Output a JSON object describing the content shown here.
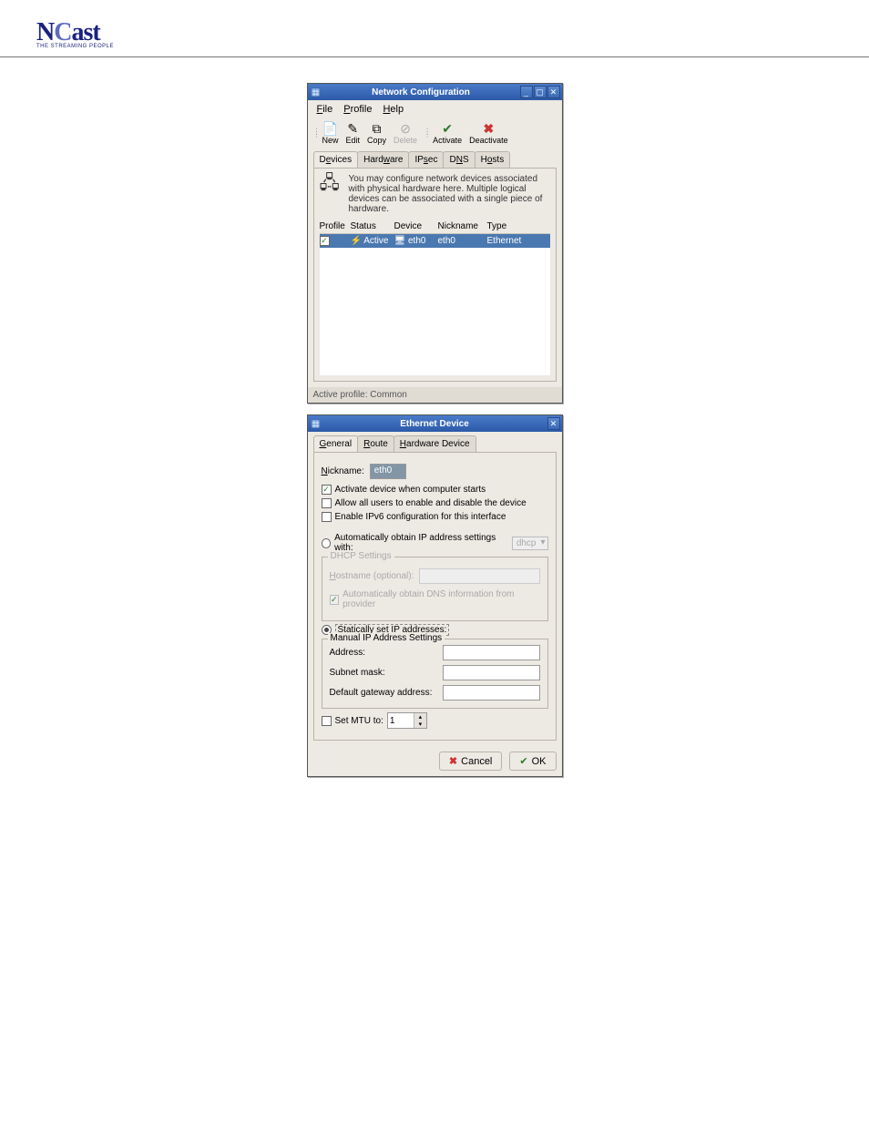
{
  "logo": {
    "text": "NCast",
    "tagline": "THE STREAMING PEOPLE"
  },
  "netconf": {
    "title": "Network Configuration",
    "menu": {
      "file": "File",
      "profile": "Profile",
      "help": "Help"
    },
    "toolbar": {
      "new": "New",
      "edit": "Edit",
      "copy": "Copy",
      "delete": "Delete",
      "activate": "Activate",
      "deactivate": "Deactivate"
    },
    "tabs": {
      "devices": "Devices",
      "hardware": "Hardware",
      "ipsec": "IPsec",
      "dns": "DNS",
      "hosts": "Hosts"
    },
    "info": "You may configure network devices associated with physical hardware here.  Multiple logical devices can be associated with a single piece of hardware.",
    "columns": {
      "profile": "Profile",
      "status": "Status",
      "device": "Device",
      "nickname": "Nickname",
      "type": "Type"
    },
    "rows": [
      {
        "profile_checked": true,
        "status": "Active",
        "device": "eth0",
        "nickname": "eth0",
        "type": "Ethernet"
      }
    ],
    "status_bar": "Active profile: Common"
  },
  "ethdev": {
    "title": "Ethernet Device",
    "tabs": {
      "general": "General",
      "route": "Route",
      "hardware": "Hardware Device"
    },
    "nickname_label": "Nickname:",
    "nickname_value": "eth0",
    "opts": {
      "activate": "Activate device when computer starts",
      "allow_users": "Allow all users to enable and disable the device",
      "ipv6": "Enable IPv6 configuration for this interface"
    },
    "auto_ip": {
      "label": "Automatically obtain IP address settings with:",
      "mode": "dhcp",
      "fieldset_title": "DHCP Settings",
      "hostname_label": "Hostname (optional):",
      "auto_dns": "Automatically obtain DNS information from provider"
    },
    "static_ip": {
      "label": "Statically set IP addresses:",
      "fieldset_title": "Manual IP Address Settings",
      "address": "Address:",
      "subnet": "Subnet mask:",
      "gateway": "Default gateway address:"
    },
    "mtu": {
      "label": "Set MTU to:",
      "value": "1"
    },
    "buttons": {
      "cancel": "Cancel",
      "ok": "OK"
    }
  }
}
